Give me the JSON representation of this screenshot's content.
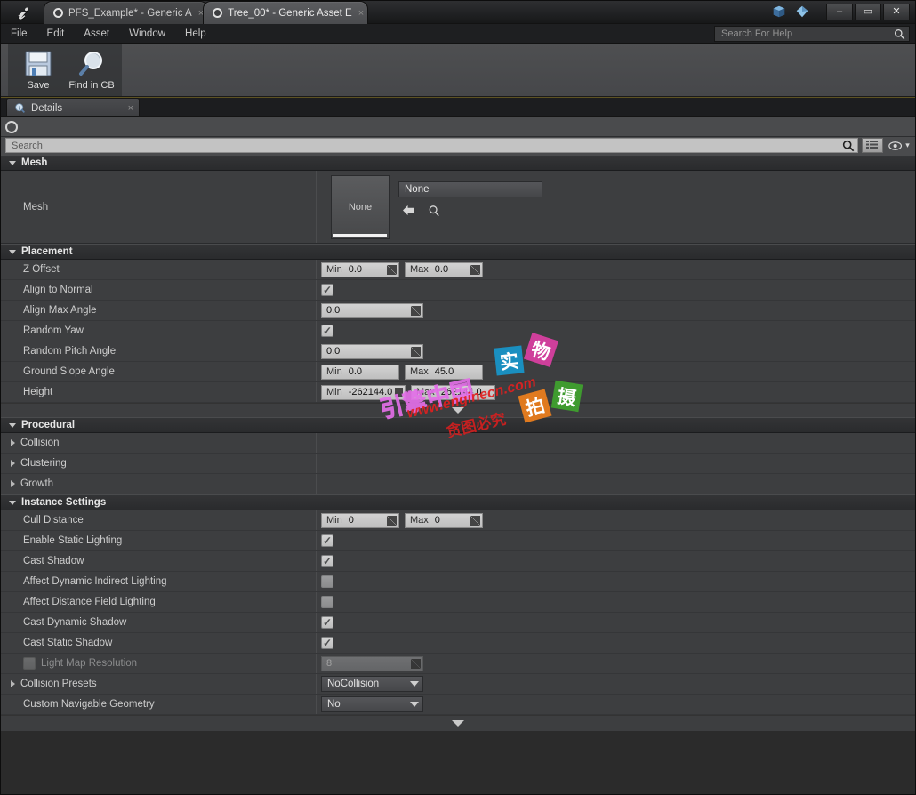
{
  "window": {
    "logo": "unreal-logo",
    "tabs": [
      {
        "label": "PFS_Example* - Generic A",
        "close": "×",
        "active": false
      },
      {
        "label": "Tree_00* - Generic Asset E",
        "close": "×",
        "active": true
      }
    ],
    "buttons": {
      "minimize": "–",
      "maximize": "▭",
      "close": "✕"
    }
  },
  "menubar": {
    "items": [
      "File",
      "Edit",
      "Asset",
      "Window",
      "Help"
    ],
    "help_search": {
      "placeholder": "Search For Help",
      "value": "",
      "icon": "search-icon"
    }
  },
  "toolbar": {
    "buttons": [
      {
        "label": "Save",
        "icon": "save-icon"
      },
      {
        "label": "Find in CB",
        "icon": "magnifier-icon"
      }
    ]
  },
  "dock": {
    "tab_label": "Details",
    "tab_icon": "details-icon",
    "close": "×"
  },
  "details": {
    "search": {
      "placeholder": "Search",
      "value": ""
    },
    "view_buttons": {
      "grid": "grid-icon",
      "eye": "eye-icon",
      "chevron": "▾"
    },
    "categories": [
      {
        "name": "Mesh",
        "expanded": true,
        "mesh_row": {
          "label": "Mesh",
          "thumbnail_text": "None",
          "combo_value": "None",
          "actions": [
            "use-selected-arrow",
            "browse-magnifier"
          ]
        }
      },
      {
        "name": "Placement",
        "expanded": true,
        "rows": [
          {
            "label": "Z Offset",
            "type": "minmax",
            "min_key": "Min",
            "min": "0.0",
            "max_key": "Max",
            "max": "0.0"
          },
          {
            "label": "Align to Normal",
            "type": "checkbox",
            "checked": true
          },
          {
            "label": "Align Max Angle",
            "type": "number",
            "value": "0.0"
          },
          {
            "label": "Random Yaw",
            "type": "checkbox",
            "checked": true
          },
          {
            "label": "Random Pitch Angle",
            "type": "number",
            "value": "0.0"
          },
          {
            "label": "Ground Slope Angle",
            "type": "minmax",
            "min_key": "Min",
            "min": "0.0",
            "max_key": "Max",
            "max": "45.0"
          },
          {
            "label": "Height",
            "type": "minmax",
            "min_key": "Min",
            "min": "-262144.0",
            "max_key": "Max",
            "max": "262144.0"
          }
        ]
      },
      {
        "name": "Procedural",
        "expanded": true,
        "rows": [
          {
            "label": "Collision",
            "type": "subgroup"
          },
          {
            "label": "Clustering",
            "type": "subgroup"
          },
          {
            "label": "Growth",
            "type": "subgroup"
          }
        ]
      },
      {
        "name": "Instance Settings",
        "expanded": true,
        "rows": [
          {
            "label": "Cull Distance",
            "type": "minmax",
            "min_key": "Min",
            "min": "0",
            "max_key": "Max",
            "max": "0"
          },
          {
            "label": "Enable Static Lighting",
            "type": "checkbox",
            "checked": true
          },
          {
            "label": "Cast Shadow",
            "type": "checkbox",
            "checked": true
          },
          {
            "label": "Affect Dynamic Indirect Lighting",
            "type": "checkbox",
            "checked": false
          },
          {
            "label": "Affect Distance Field Lighting",
            "type": "checkbox",
            "checked": false
          },
          {
            "label": "Cast Dynamic Shadow",
            "type": "checkbox",
            "checked": true
          },
          {
            "label": "Cast Static Shadow",
            "type": "checkbox",
            "checked": true
          },
          {
            "label": "Light Map Resolution",
            "type": "number-disabled",
            "value": "8",
            "has_checkbox": true,
            "disabled": true
          },
          {
            "label": "Collision Presets",
            "type": "dropdown",
            "value": "NoCollision",
            "expandable": true
          },
          {
            "label": "Custom Navigable Geometry",
            "type": "dropdown",
            "value": "No"
          }
        ]
      }
    ],
    "scroll_down": "▼"
  },
  "watermark": {
    "brand": "引擎中国",
    "url": "www.enginecn.com",
    "notice": "贪图必究",
    "boxes": [
      {
        "char": "实",
        "color": "#1a8fc0"
      },
      {
        "char": "物",
        "color": "#cf3f9b"
      },
      {
        "char": "拍",
        "color": "#e07a1f"
      },
      {
        "char": "摄",
        "color": "#3f9b2f"
      }
    ]
  }
}
